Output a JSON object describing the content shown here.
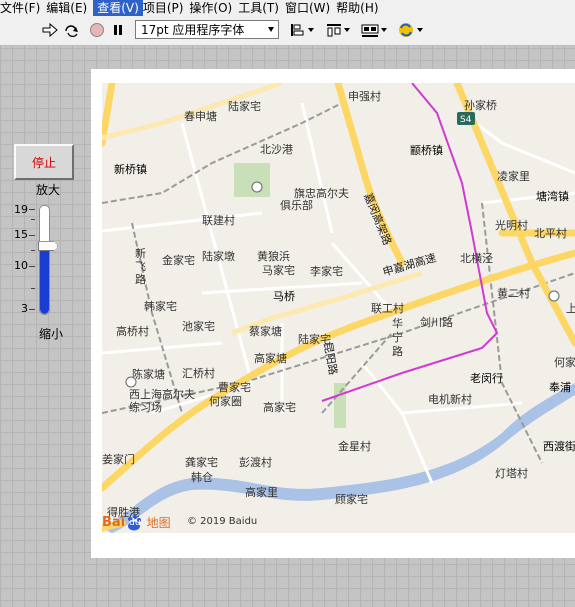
{
  "menu": {
    "items": [
      {
        "label": "文件(F)",
        "active": false
      },
      {
        "label": "编辑(E)",
        "active": false
      },
      {
        "label": "查看(V)",
        "active": true
      },
      {
        "label": "项目(P)",
        "active": false
      },
      {
        "label": "操作(O)",
        "active": false
      },
      {
        "label": "工具(T)",
        "active": false
      },
      {
        "label": "窗口(W)",
        "active": false
      },
      {
        "label": "帮助(H)",
        "active": false
      }
    ]
  },
  "toolbar": {
    "font_select_value": "17pt 应用程序字体",
    "icons": [
      "run-arrow-icon",
      "run-continuously-icon",
      "abort-icon",
      "pause-icon",
      "align-icon",
      "distribute-icon",
      "resize-icon",
      "reorder-icon"
    ]
  },
  "controls": {
    "stop_label": "停止",
    "zoom_in_label": "放大",
    "zoom_out_label": "缩小",
    "slider": {
      "min": 3,
      "max": 19,
      "value": 13,
      "ticks": [
        "19",
        "15",
        "10",
        "3"
      ]
    }
  },
  "map": {
    "places": [
      "陆家宅",
      "春申塘",
      "北沙港",
      "新桥镇",
      "旗忠高尔夫",
      "俱乐部",
      "联建村",
      "金家宅",
      "陆家墩",
      "黄狼浜",
      "马家宅",
      "李家宅",
      "新飞路",
      "韩家宅",
      "马桥",
      "高桥村",
      "池家宅",
      "蔡家塘",
      "陆家宅",
      "高家塘",
      "陈家塘",
      "汇桥村",
      "曹家宅",
      "西上海高尔夫",
      "练习场",
      "何家圈",
      "高家宅",
      "申强村",
      "孙家桥",
      "颛桥镇",
      "凌家里",
      "塘湾镇",
      "光明村",
      "北平村",
      "北横泾",
      "黄二村",
      "联工村",
      "华宁路",
      "剑川路",
      "老闵行",
      "电机新村",
      "金星村",
      "奉浦",
      "西渡街",
      "灯塔村",
      "龚家宅",
      "韩仓",
      "彭渡村",
      "高家里",
      "顾家宅",
      "得胜港",
      "姜家门",
      "何家",
      "上"
    ],
    "roads": [
      "嘉闵高架路",
      "申嘉湖高速",
      "昆阳路"
    ],
    "badge": "S4",
    "logo_text": "Bai",
    "logo_text2": "du",
    "logo_text3": "地图",
    "copyright": "© 2019 Baidu"
  }
}
